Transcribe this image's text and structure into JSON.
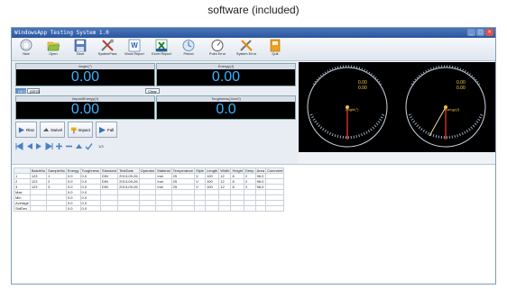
{
  "caption": "software (included)",
  "window": {
    "title": "WindowsApp Testing System 1.0",
    "controls": {
      "min": "_",
      "max": "□",
      "close": "×"
    }
  },
  "toolbar": {
    "items": [
      {
        "label": "New",
        "icon": "new-icon"
      },
      {
        "label": "Open",
        "icon": "open-folder-icon"
      },
      {
        "label": "Save",
        "icon": "save-disk-icon"
      },
      {
        "label": "SystemPara",
        "icon": "tools-icon"
      },
      {
        "label": "Word Report",
        "icon": "word-icon"
      },
      {
        "label": "Excel Report",
        "icon": "excel-icon"
      },
      {
        "label": "Period",
        "icon": "period-icon"
      },
      {
        "label": "Point Error",
        "icon": "point-error-icon"
      },
      {
        "label": "System Error",
        "icon": "system-error-icon"
      },
      {
        "label": "Quit",
        "icon": "quit-icon"
      }
    ]
  },
  "displays": {
    "angle": {
      "label": "Angle(°)",
      "value": "0.00"
    },
    "energy": {
      "label": "Energy(J)",
      "value": "0.00"
    },
    "impact_energy": {
      "label": "ImpactEnergy(J)",
      "value": "0.00"
    },
    "toughness": {
      "label": "Toughness(J/cm2)",
      "value": "0.0"
    }
  },
  "unit_tabs": [
    "DEG",
    "(DEG)"
  ],
  "clear_label": "Clear",
  "actions": [
    {
      "label": "Rise"
    },
    {
      "label": "Swivel"
    },
    {
      "label": "Impact"
    },
    {
      "label": "Fall"
    }
  ],
  "pager": {
    "text": "1/3"
  },
  "gauges": {
    "left": {
      "label": "Angle(°)",
      "top_value": "0.00",
      "bottom_value": "0.00",
      "needle_fraction": 0.0
    },
    "right": {
      "label": "Energy(J)",
      "top_value": "0.00",
      "bottom_value": "0.00",
      "needle_fraction": 0.0
    }
  },
  "table": {
    "columns": [
      "",
      "BatchNo",
      "SampleNo",
      "Energy",
      "Toughness",
      "Standard",
      "TestDate",
      "Operator",
      "Material",
      "Temperature",
      "Style",
      "Length",
      "Width",
      "Height",
      "Deep",
      "Area",
      "Comment"
    ],
    "rows": [
      [
        "1",
        "123",
        "1",
        "0.0",
        "0.0",
        "DIN",
        "2013-09-26",
        "",
        "Iron",
        "25",
        "V",
        "100",
        "12",
        "8",
        "2",
        "96.0",
        ""
      ],
      [
        "2",
        "123",
        "2",
        "0.0",
        "0.0",
        "DIN",
        "2013-09-26",
        "",
        "Iron",
        "25",
        "V",
        "100",
        "12",
        "8",
        "2",
        "96.0",
        ""
      ],
      [
        "3",
        "123",
        "3",
        "0.0",
        "0.0",
        "DIN",
        "2013-09-26",
        "",
        "Iron",
        "25",
        "V",
        "100",
        "12",
        "8",
        "2",
        "96.0",
        ""
      ],
      [
        "Max",
        "",
        "",
        "0.0",
        "0.0",
        "",
        "",
        "",
        "",
        "",
        "",
        "",
        "",
        "",
        "",
        "",
        ""
      ],
      [
        "Min",
        "",
        "",
        "0.0",
        "0.0",
        "",
        "",
        "",
        "",
        "",
        "",
        "",
        "",
        "",
        "",
        "",
        ""
      ],
      [
        "Average",
        "",
        "",
        "0.0",
        "0.0",
        "",
        "",
        "",
        "",
        "",
        "",
        "",
        "",
        "",
        "",
        "",
        ""
      ],
      [
        "StdDev",
        "",
        "",
        "0.0",
        "0.0",
        "",
        "",
        "",
        "",
        "",
        "",
        "",
        "",
        "",
        "",
        "",
        ""
      ]
    ]
  }
}
